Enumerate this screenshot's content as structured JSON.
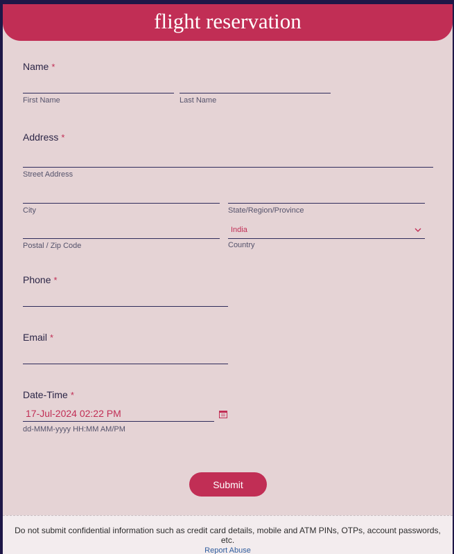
{
  "header": {
    "title": "flight reservation"
  },
  "form": {
    "name": {
      "label": "Name",
      "required_mark": "*",
      "first_sub": "First Name",
      "last_sub": "Last Name"
    },
    "address": {
      "label": "Address",
      "required_mark": "*",
      "street_sub": "Street Address",
      "city_sub": "City",
      "state_sub": "State/Region/Province",
      "postal_sub": "Postal / Zip Code",
      "country_sub": "Country",
      "country_value": "India"
    },
    "phone": {
      "label": "Phone",
      "required_mark": "*"
    },
    "email": {
      "label": "Email",
      "required_mark": "*"
    },
    "datetime": {
      "label": "Date-Time",
      "required_mark": "*",
      "value": "17-Jul-2024 02:22 PM",
      "format_hint": "dd-MMM-yyyy HH:MM AM/PM"
    },
    "submit_label": "Submit"
  },
  "footer": {
    "notice": "Do not submit confidential information such as credit card details, mobile and ATM PINs, OTPs, account passwords, etc.",
    "report_link": "Report Abuse"
  },
  "icons": {
    "country_dropdown": "chevron-down-icon",
    "datetime_picker": "calendar-icon"
  },
  "colors": {
    "accent": "#c12e55",
    "background": "#e5d3d5",
    "frame": "#1e1747",
    "link": "#2f5d9e"
  }
}
